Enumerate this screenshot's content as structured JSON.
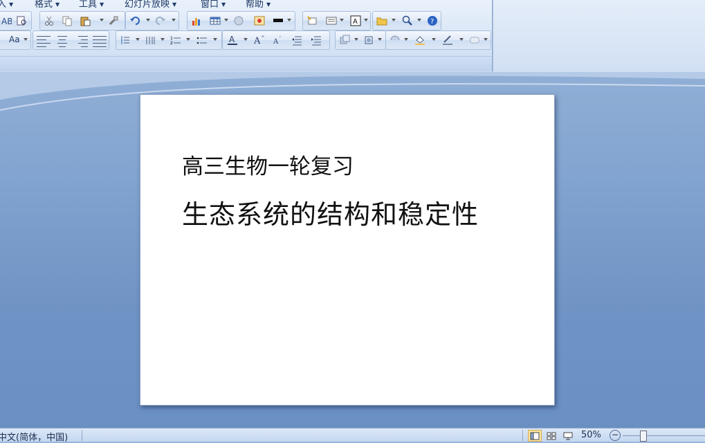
{
  "menu": [
    {
      "label": "入"
    },
    {
      "label": "格式"
    },
    {
      "label": "工具"
    },
    {
      "label": "幻灯片放映"
    },
    {
      "label": "窗口"
    },
    {
      "label": "帮助"
    }
  ],
  "toolbar_row2": {
    "font_size_label": "Aa"
  },
  "slide": {
    "subtitle": "高三生物一轮复习",
    "title": "生态系统的结构和稳定性"
  },
  "status": {
    "language": "中文(简体，中国)",
    "zoom": "50%"
  },
  "colors": {
    "ribbon": "#d5e3f5",
    "workspace": "#7f9fcc",
    "slide_bg": "#ffffff"
  }
}
